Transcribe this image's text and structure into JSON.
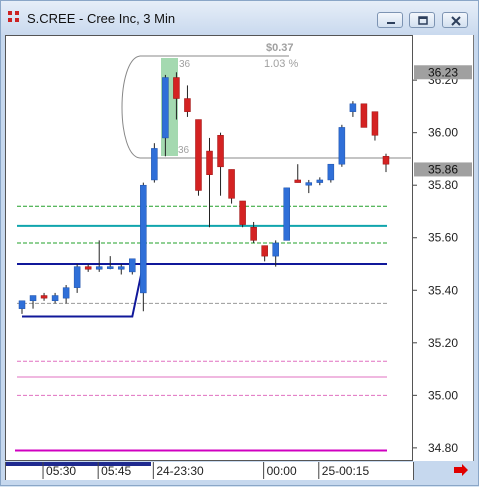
{
  "window": {
    "title": "S.CREE - Cree Inc, 3 Min",
    "buttons": [
      "minimize",
      "restore",
      "close"
    ]
  },
  "colors": {
    "up_candle": "#2f6fd8",
    "down_candle": "#d42222",
    "trend_line": "#10189a",
    "line_green": "#22a02a",
    "line_teal": "#10a5ad",
    "line_pink": "#e070c0",
    "line_magenta": "#d000c0",
    "line_gray": "#9a9a9a",
    "price_label_bg": "#a0a0a0",
    "annotation_highlight": "#7dc98f"
  },
  "measure_tool": {
    "change": "$0.37",
    "percent": "1.03 %",
    "start_label": "36",
    "end_label": "36"
  },
  "price_axis": {
    "ticks": [
      "36.20",
      "36.00",
      "35.80",
      "35.60",
      "35.40",
      "35.20",
      "35.00",
      "34.80"
    ],
    "highlight_labels": [
      "36.23",
      "35.86"
    ]
  },
  "time_axis": {
    "ticks": [
      "05:30",
      "05:45",
      "24-23:30",
      "00:00",
      "25-00:15"
    ]
  },
  "chart_data": {
    "type": "candlestick",
    "ylim": [
      34.75,
      36.33
    ],
    "candles": [
      {
        "o": 35.33,
        "h": 35.36,
        "l": 35.31,
        "c": 35.36
      },
      {
        "o": 35.36,
        "h": 35.38,
        "l": 35.33,
        "c": 35.38
      },
      {
        "o": 35.38,
        "h": 35.39,
        "l": 35.36,
        "c": 35.37
      },
      {
        "o": 35.36,
        "h": 35.39,
        "l": 35.35,
        "c": 35.38
      },
      {
        "o": 35.37,
        "h": 35.42,
        "l": 35.35,
        "c": 35.41
      },
      {
        "o": 35.41,
        "h": 35.5,
        "l": 35.39,
        "c": 35.49
      },
      {
        "o": 35.49,
        "h": 35.5,
        "l": 35.47,
        "c": 35.48
      },
      {
        "o": 35.48,
        "h": 35.59,
        "l": 35.47,
        "c": 35.49
      },
      {
        "o": 35.49,
        "h": 35.53,
        "l": 35.48,
        "c": 35.49
      },
      {
        "o": 35.48,
        "h": 35.5,
        "l": 35.46,
        "c": 35.49
      },
      {
        "o": 35.47,
        "h": 35.51,
        "l": 35.46,
        "c": 35.52
      },
      {
        "o": 35.39,
        "h": 35.81,
        "l": 35.32,
        "c": 35.8
      },
      {
        "o": 35.82,
        "h": 35.96,
        "l": 35.81,
        "c": 35.94
      },
      {
        "o": 35.98,
        "h": 36.22,
        "l": 35.91,
        "c": 36.21
      },
      {
        "o": 36.21,
        "h": 36.23,
        "l": 36.05,
        "c": 36.13
      },
      {
        "o": 36.13,
        "h": 36.18,
        "l": 36.06,
        "c": 36.08
      },
      {
        "o": 36.05,
        "h": 36.05,
        "l": 35.76,
        "c": 35.78
      },
      {
        "o": 35.93,
        "h": 35.98,
        "l": 35.64,
        "c": 35.84
      },
      {
        "o": 35.99,
        "h": 36.0,
        "l": 35.76,
        "c": 35.87
      },
      {
        "o": 35.86,
        "h": 35.86,
        "l": 35.73,
        "c": 35.75
      },
      {
        "o": 35.74,
        "h": 35.74,
        "l": 35.64,
        "c": 35.65
      },
      {
        "o": 35.64,
        "h": 35.66,
        "l": 35.58,
        "c": 35.59
      },
      {
        "o": 35.57,
        "h": 35.57,
        "l": 35.51,
        "c": 35.53
      },
      {
        "o": 35.53,
        "h": 35.59,
        "l": 35.49,
        "c": 35.58
      },
      {
        "o": 35.59,
        "h": 35.79,
        "l": 35.59,
        "c": 35.79
      },
      {
        "o": 35.82,
        "h": 35.88,
        "l": 35.81,
        "c": 35.81
      },
      {
        "o": 35.8,
        "h": 35.82,
        "l": 35.77,
        "c": 35.81
      },
      {
        "o": 35.81,
        "h": 35.83,
        "l": 35.8,
        "c": 35.82
      },
      {
        "o": 35.82,
        "h": 35.88,
        "l": 35.81,
        "c": 35.88
      },
      {
        "o": 35.88,
        "h": 36.03,
        "l": 35.87,
        "c": 36.02
      },
      {
        "o": 36.08,
        "h": 36.12,
        "l": 36.06,
        "c": 36.11
      },
      {
        "o": 36.11,
        "h": 36.11,
        "l": 36.02,
        "c": 36.02
      },
      {
        "o": 36.08,
        "h": 36.08,
        "l": 35.97,
        "c": 35.99
      },
      {
        "o": 35.91,
        "h": 35.92,
        "l": 35.85,
        "c": 35.88
      }
    ],
    "horizontal_lines": [
      {
        "price": 35.72,
        "color": "line_green",
        "style": "dashed"
      },
      {
        "price": 35.645,
        "color": "line_teal",
        "style": "solid"
      },
      {
        "price": 35.58,
        "color": "line_green",
        "style": "dashed"
      },
      {
        "price": 35.5,
        "color": "trend_line",
        "style": "solid"
      },
      {
        "price": 35.35,
        "color": "line_gray",
        "style": "dashed"
      },
      {
        "price": 35.13,
        "color": "line_pink",
        "style": "dashed"
      },
      {
        "price": 35.07,
        "color": "line_pink",
        "style": "solid"
      },
      {
        "price": 35.0,
        "color": "line_pink",
        "style": "dashed"
      },
      {
        "price": 34.79,
        "color": "line_magenta",
        "style": "solid"
      }
    ],
    "trend_line": [
      {
        "i": 0,
        "p": 35.3
      },
      {
        "i": 10,
        "p": 35.3
      },
      {
        "i": 11,
        "p": 35.5
      },
      {
        "i": 33,
        "p": 35.5
      }
    ]
  }
}
